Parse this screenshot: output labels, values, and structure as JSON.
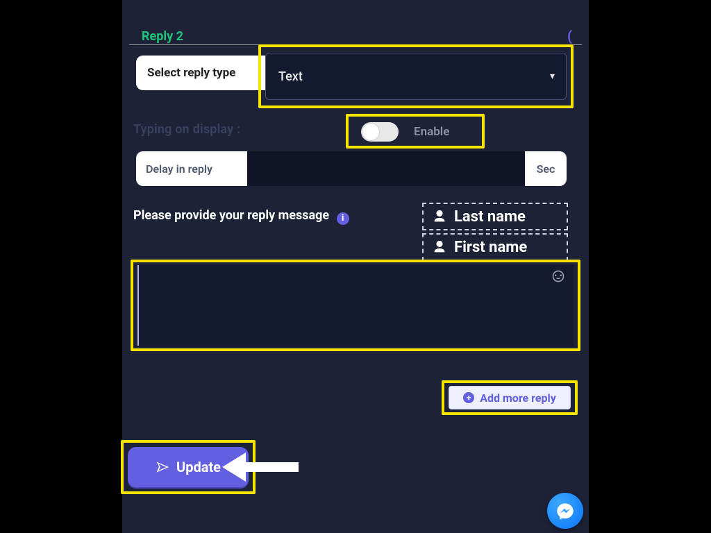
{
  "tab_title": "Reply 2",
  "select": {
    "label": "Select reply type",
    "value": "Text"
  },
  "typing": {
    "label": "Typing on display :",
    "toggle_label": "Enable"
  },
  "delay": {
    "label": "Delay in reply",
    "unit": "Sec"
  },
  "provide_label": "Please provide your reply message",
  "chips": {
    "last": "Last name",
    "first": "First name"
  },
  "addmore_label": "Add more reply",
  "update_label": "Update"
}
